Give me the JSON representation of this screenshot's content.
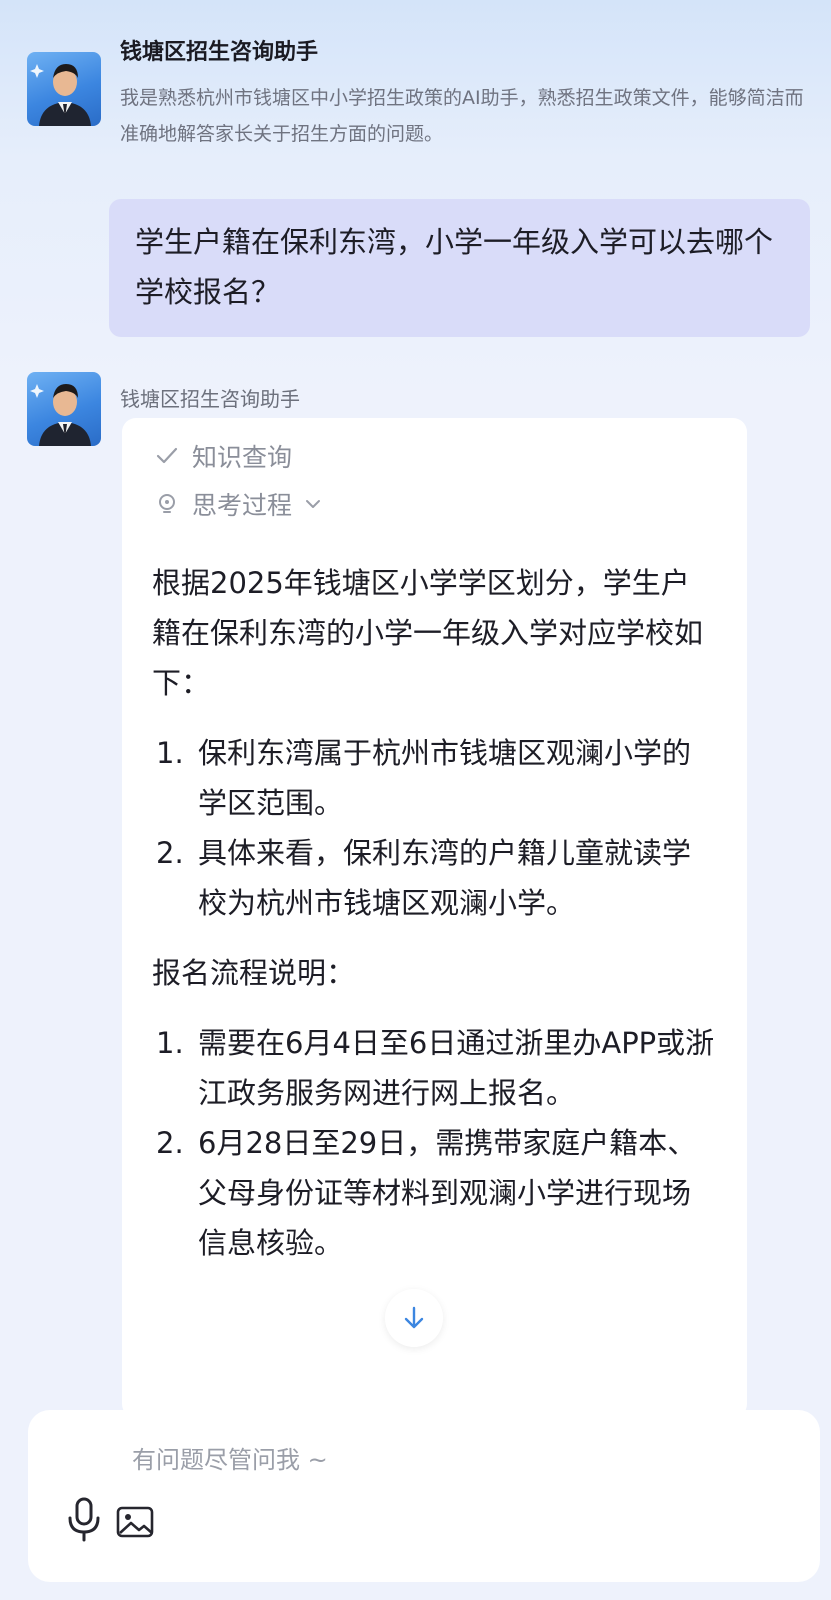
{
  "header": {
    "title": "钱塘区招生咨询助手",
    "description": "我是熟悉杭州市钱塘区中小学招生政策的AI助手，熟悉招生政策文件，能够简洁而准确地解答家长关于招生方面的问题。"
  },
  "user_message": "学生户籍在保利东湾，小学一年级入学可以去哪个学校报名？",
  "bot": {
    "name": "钱塘区招生咨询助手",
    "tool_done_label": "知识查询",
    "thinking_label": "思考过程",
    "intro": "根据2025年钱塘区小学学区划分，学生户籍在保利东湾的小学一年级入学对应学校如下：",
    "list1": [
      {
        "num": "1.",
        "text": "保利东湾属于杭州市钱塘区观澜小学的学区范围。"
      },
      {
        "num": "2.",
        "text": "具体来看，保利东湾的户籍儿童就读学校为杭州市钱塘区观澜小学。"
      }
    ],
    "section_title": "报名流程说明：",
    "list2": [
      {
        "num": "1.",
        "text": "需要在6月4日至6日通过浙里办APP或浙江政务服务网进行网上报名。"
      },
      {
        "num": "2.",
        "text": "6月28日至29日，需携带家庭户籍本、父母身份证等材料到观澜小学进行现场信息核验。"
      }
    ]
  },
  "input": {
    "placeholder": "有问题尽管问我 ~"
  },
  "icons": {
    "check": "check-icon",
    "thinking": "lightbulb-icon",
    "chevron": "chevron-down-icon",
    "scroll": "arrow-down-icon",
    "mic": "microphone-icon",
    "image": "image-icon"
  },
  "colors": {
    "user_bubble": "#d9dcf9",
    "muted_text": "#8a8e99",
    "accent": "#3c86e0"
  }
}
